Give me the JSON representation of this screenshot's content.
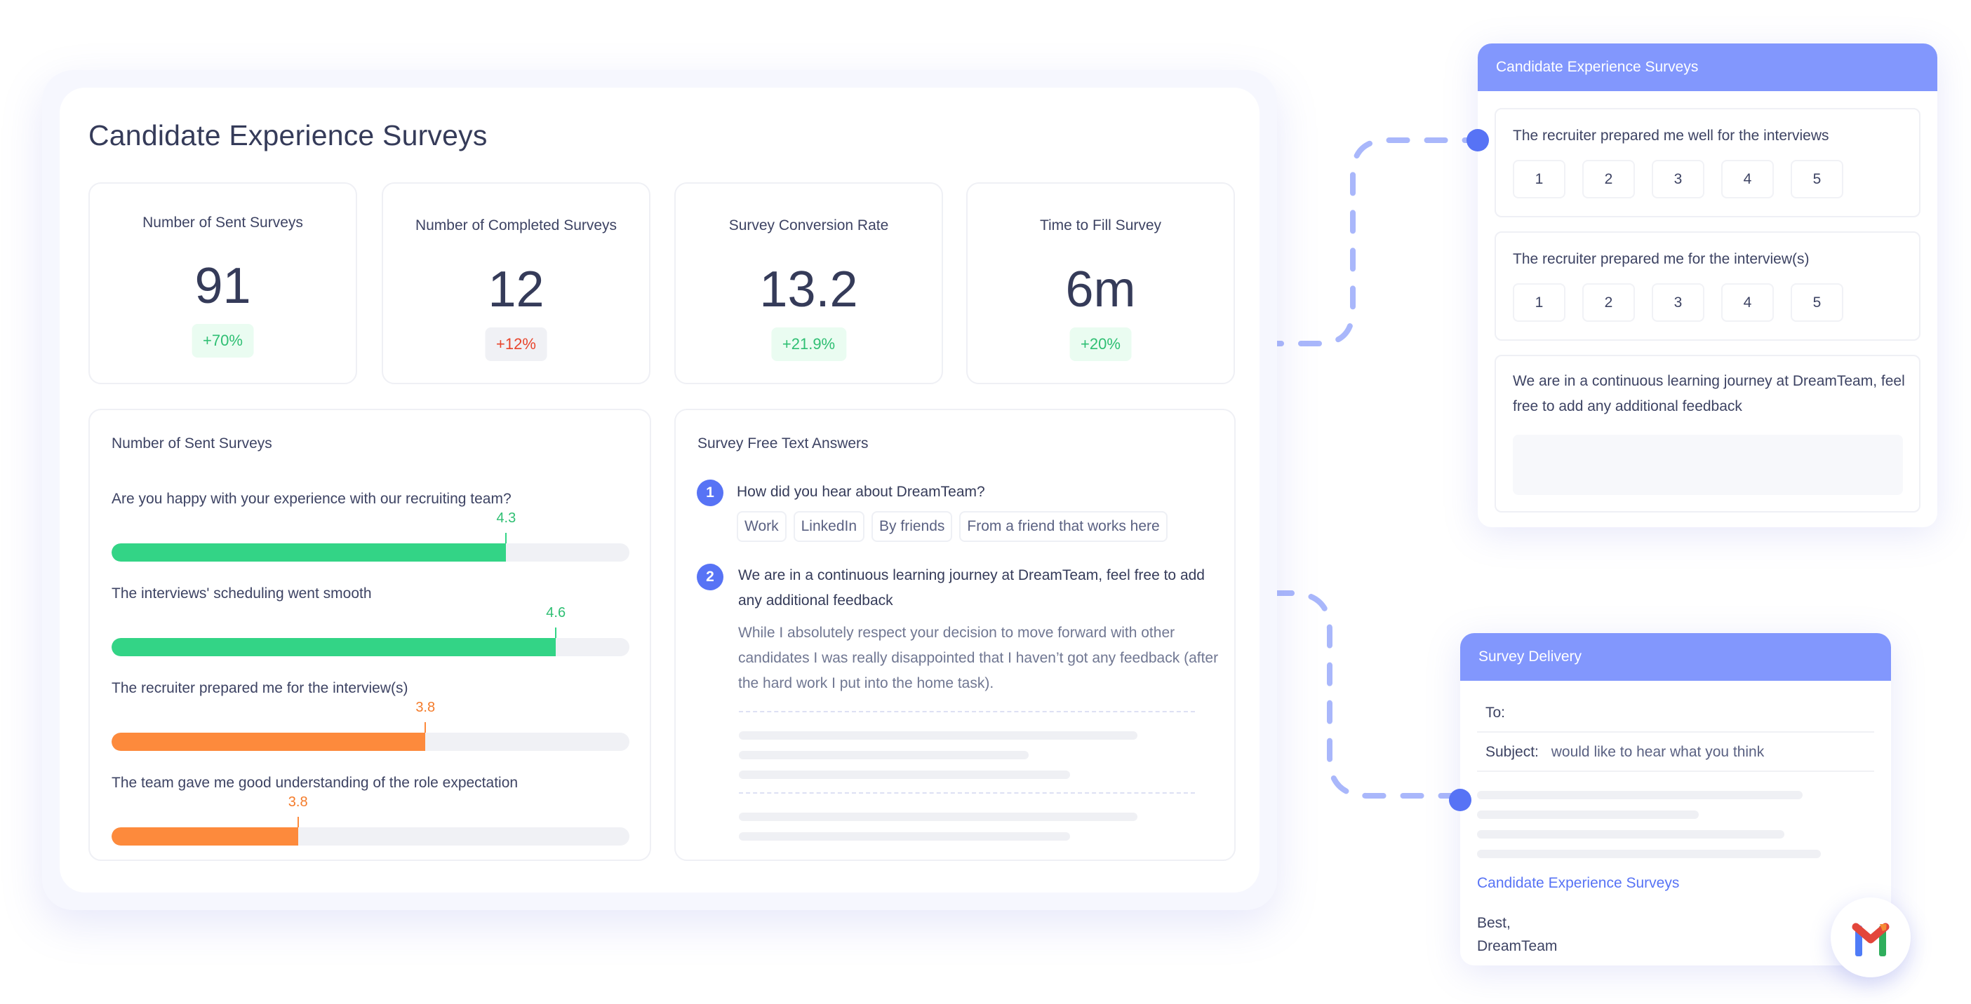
{
  "dashboard": {
    "title": "Candidate Experience Surveys",
    "kpis": [
      {
        "label": "Number of Sent Surveys",
        "value": "91",
        "delta": "+70%",
        "trend": "positive"
      },
      {
        "label": "Number of Completed Surveys",
        "value": "12",
        "delta": "+12%",
        "trend": "negative"
      },
      {
        "label": "Survey Conversion Rate",
        "value": "13.2",
        "delta": "+21.9%",
        "trend": "positive"
      },
      {
        "label": "Time to Fill Survey",
        "value": "6m",
        "delta": "+20%",
        "trend": "positive"
      }
    ],
    "ratings_panel": {
      "title": "Number of Sent Surveys",
      "items": [
        {
          "question": "Are you happy with your experience with our recruiting team?",
          "score": "4.3",
          "fill_fraction": 0.762,
          "color": "#33d486"
        },
        {
          "question": "The interviews' scheduling went smooth",
          "score": "4.6",
          "fill_fraction": 0.858,
          "color": "#33d486"
        },
        {
          "question": "The recruiter prepared me for the interview(s)",
          "score": "3.8",
          "fill_fraction": 0.606,
          "color": "#fd8a3c"
        },
        {
          "question": "The team gave me good understanding of the role expectation",
          "score": "3.8",
          "fill_fraction": 0.36,
          "color": "#fd8a3c"
        }
      ]
    },
    "free_text_panel": {
      "title": "Survey Free Text Answers",
      "questions": [
        {
          "number": "1",
          "text": "How did you hear about DreamTeam?",
          "chips": [
            "Work",
            "LinkedIn",
            "By friends",
            "From a friend that works here"
          ]
        },
        {
          "number": "2",
          "text": "We are in a continuous learning journey at DreamTeam, feel free to add any additional feedback",
          "answer": "While I absolutely respect your decision to move forward with other candidates I was really disappointed that I haven’t got any feedback (after the hard work I put into the home task)."
        }
      ]
    }
  },
  "survey_form": {
    "header": "Candidate Experience Surveys",
    "questions": [
      {
        "text": "The recruiter prepared me well for the interviews",
        "scale": [
          "1",
          "2",
          "3",
          "4",
          "5"
        ]
      },
      {
        "text": "The recruiter prepared me for the interview(s)",
        "scale": [
          "1",
          "2",
          "3",
          "4",
          "5"
        ]
      },
      {
        "text": "We are in a continuous learning journey at DreamTeam, feel free to add any additional feedback",
        "input_value": ""
      }
    ]
  },
  "delivery": {
    "header": "Survey Delivery",
    "to_label": "To:",
    "to_value": "",
    "subject_label": "Subject:",
    "subject_value": "would like to hear what you think",
    "link_text": "Candidate Experience Surveys",
    "sign_off": "Best,",
    "signature": "DreamTeam",
    "integration_icon": "gmail-icon"
  },
  "colors": {
    "accent": "#5773f5",
    "header_blue": "#8297fd",
    "positive": "#33d486",
    "warning": "#fd8a3c",
    "negative": "#e8452c"
  }
}
